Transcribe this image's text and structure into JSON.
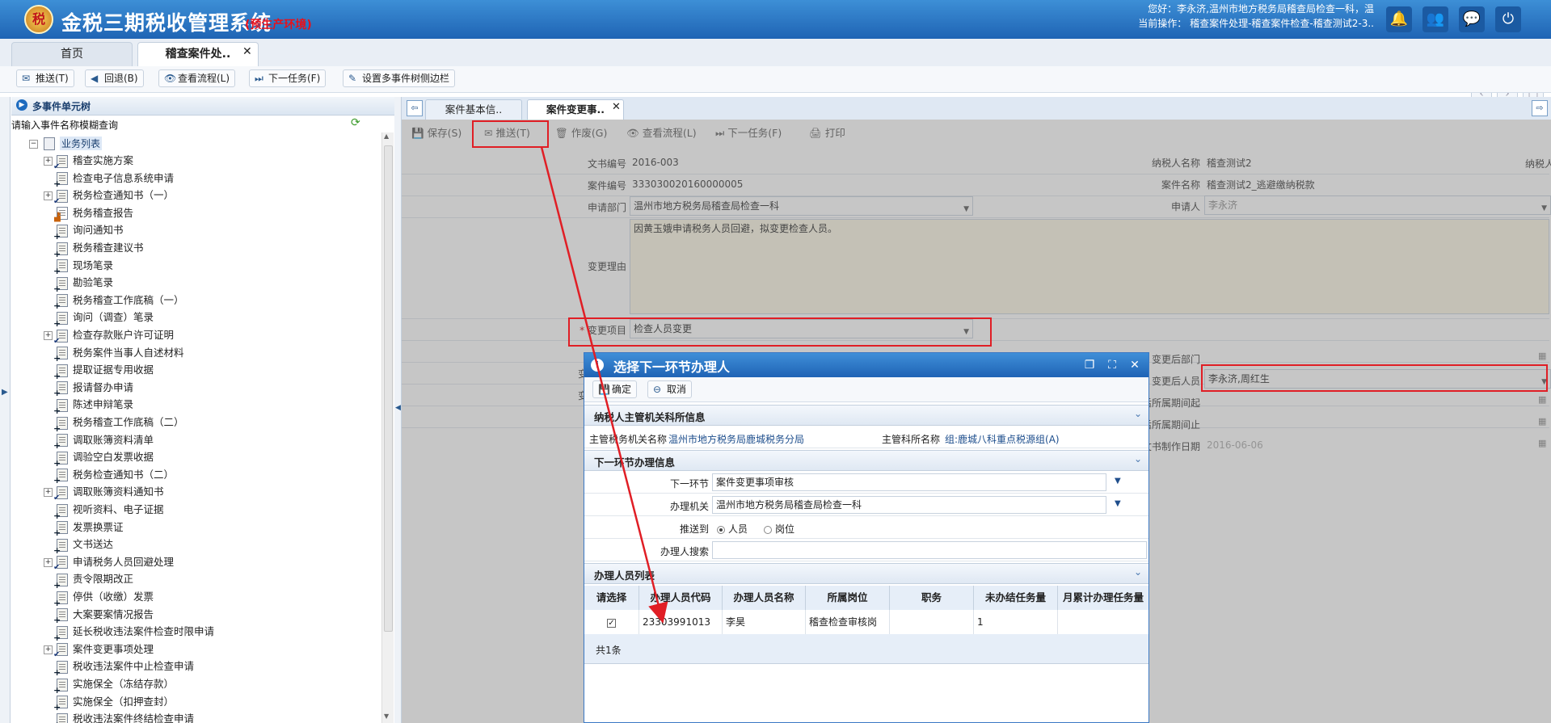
{
  "header": {
    "app_title": "金税三期税收管理系统",
    "env_label": "(预生产环境)",
    "user_line1": "您好：李永济,温州市地方税务局稽查局检查一科，温",
    "user_line2": "当前操作： 稽查案件处理-稽查案件检查-稽查测试2-3..",
    "icons": [
      "bell-icon",
      "users-icon",
      "chat-icon",
      "power-icon"
    ]
  },
  "main_tabs": [
    {
      "label": "首页"
    },
    {
      "label": "稽查案件处.."
    }
  ],
  "toolbar": {
    "push": "推送(T)",
    "back": "回退(B)",
    "view_flow": "查看流程(L)",
    "next_task": "下一任务(F)",
    "set_sidebar": "设置多事件树侧边栏"
  },
  "left_panel": {
    "title": "多事件单元树",
    "search_label": "请输入事件名称模糊查询",
    "root": "业务列表",
    "items": [
      {
        "label": "稽查实施方案",
        "exp": true,
        "icon": "check"
      },
      {
        "label": "检查电子信息系统申请",
        "exp": false,
        "icon": "plus"
      },
      {
        "label": "税务检查通知书（一）",
        "exp": true,
        "icon": "check"
      },
      {
        "label": "税务稽查报告",
        "exp": false,
        "icon": "chart"
      },
      {
        "label": "询问通知书",
        "exp": false,
        "icon": "plus"
      },
      {
        "label": "税务稽查建议书",
        "exp": false,
        "icon": "plus"
      },
      {
        "label": "现场笔录",
        "exp": false,
        "icon": "plus"
      },
      {
        "label": "勘验笔录",
        "exp": false,
        "icon": "plus"
      },
      {
        "label": "税务稽查工作底稿（一）",
        "exp": false,
        "icon": "plus"
      },
      {
        "label": "询问（调查）笔录",
        "exp": false,
        "icon": "plus"
      },
      {
        "label": "检查存款账户许可证明",
        "exp": true,
        "icon": "check"
      },
      {
        "label": "税务案件当事人自述材料",
        "exp": false,
        "icon": "plus"
      },
      {
        "label": "提取证据专用收据",
        "exp": false,
        "icon": "plus"
      },
      {
        "label": "报请督办申请",
        "exp": false,
        "icon": "plus"
      },
      {
        "label": "陈述申辩笔录",
        "exp": false,
        "icon": "plus"
      },
      {
        "label": "税务稽查工作底稿（二）",
        "exp": false,
        "icon": "plus"
      },
      {
        "label": "调取账簿资料清单",
        "exp": false,
        "icon": "plus"
      },
      {
        "label": "调验空白发票收据",
        "exp": false,
        "icon": "plus"
      },
      {
        "label": "税务检查通知书（二）",
        "exp": false,
        "icon": "plus"
      },
      {
        "label": "调取账簿资料通知书",
        "exp": true,
        "icon": "check"
      },
      {
        "label": "视听资料、电子证据",
        "exp": false,
        "icon": "plus"
      },
      {
        "label": "发票换票证",
        "exp": false,
        "icon": "plus"
      },
      {
        "label": "文书送达",
        "exp": false,
        "icon": "plus"
      },
      {
        "label": "申请税务人员回避处理",
        "exp": true,
        "icon": "check"
      },
      {
        "label": "责令限期改正",
        "exp": false,
        "icon": "plus"
      },
      {
        "label": "停供（收缴）发票",
        "exp": false,
        "icon": "plus"
      },
      {
        "label": "大案要案情况报告",
        "exp": false,
        "icon": "plus"
      },
      {
        "label": "延长税收违法案件检查时限申请",
        "exp": false,
        "icon": "plus"
      },
      {
        "label": "案件变更事项处理",
        "exp": true,
        "icon": "check"
      },
      {
        "label": "税收违法案件中止检查申请",
        "exp": false,
        "icon": "plus"
      },
      {
        "label": "实施保全（冻结存款）",
        "exp": false,
        "icon": "plus"
      },
      {
        "label": "实施保全（扣押查封）",
        "exp": false,
        "icon": "plus"
      },
      {
        "label": "税收违法案件终结检查申请",
        "exp": false,
        "icon": "plus"
      }
    ]
  },
  "content": {
    "tabs": [
      {
        "label": "案件基本信.."
      },
      {
        "label": "案件变更事.."
      }
    ],
    "toolbar": {
      "save": "保存(S)",
      "push": "推送(T)",
      "void": "作废(G)",
      "view_flow": "查看流程(L)",
      "next_task": "下一任务(F)",
      "print": "打印"
    },
    "form": {
      "doc_no_label": "文书编号",
      "doc_no": "2016-003",
      "taxpayer_label": "纳税人名称",
      "taxpayer": "稽查测试2",
      "case_no_label": "案件编号",
      "case_no": "333030020160000005",
      "case_name_label": "案件名称",
      "case_name": "稽查测试2_逃避缴纳税款",
      "dept_label": "申请部门",
      "dept": "温州市地方税务局稽查局检查一科",
      "applicant_label": "申请人",
      "applicant": "李永济",
      "reason_label": "变更理由",
      "reason": "因黄玉娥申请税务人员回避，拟变更检查人员。",
      "item_label": "变更项目",
      "item": "检查人员变更",
      "after_dept_label": "变更后部门",
      "after_person_label": "变更后人员",
      "after_person": "李永济,周红生",
      "before_start_label": "变更前检查",
      "after_start_label": "变更后所属期间起",
      "before_end_label": "变更前检查",
      "after_end_label": "变更后所属期间止",
      "doc_date_label": "文书制作日期",
      "doc_date": "2016-06-06"
    }
  },
  "dialog": {
    "title": "选择下一环节办理人",
    "ok": "确定",
    "cancel": "取消",
    "sec1_title": "纳税人主管机关科所信息",
    "org_label": "主管税务机关名称",
    "org": "温州市地方税务局鹿城税务分局",
    "section_label": "主管科所名称",
    "section": "组:鹿城八科重点税源组(A)",
    "sec2_title": "下一环节办理信息",
    "next_step_label": "下一环节",
    "next_step": "案件变更事项审核",
    "handler_org_label": "办理机关",
    "handler_org": "温州市地方税务局稽查局检查一科",
    "push_to_label": "推送到",
    "opt_person": "人员",
    "opt_post": "岗位",
    "search_label": "办理人搜索",
    "sec3_title": "办理人员列表",
    "columns": [
      "请选择",
      "办理人员代码",
      "办理人员名称",
      "所属岗位",
      "职务",
      "未办结任务量",
      "月累计办理任务量"
    ],
    "rows": [
      {
        "code": "23303991013",
        "name": "李昊",
        "post": "稽查检查审核岗",
        "duty": "",
        "pending": "1",
        "monthly": ""
      }
    ],
    "footer": "共1条"
  },
  "colors": {
    "header_blue": "#1f64b4",
    "annotation_red": "#e01e25",
    "env_red": "#e8101a"
  }
}
